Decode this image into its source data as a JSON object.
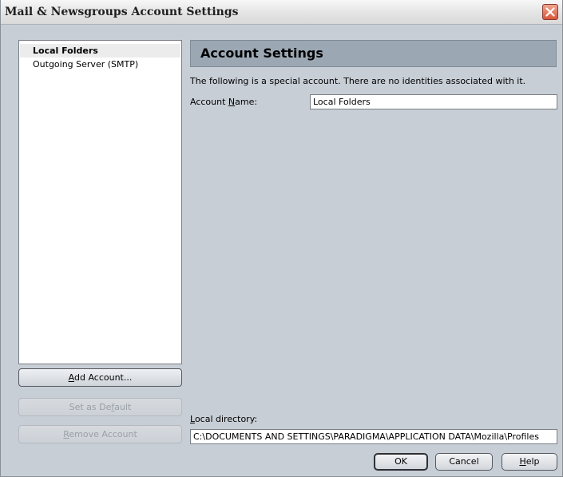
{
  "window": {
    "title": "Mail & Newsgroups Account Settings",
    "close_icon": "close-icon"
  },
  "sidebar": {
    "items": [
      {
        "label": "Local Folders",
        "selected": true
      },
      {
        "label": "Outgoing Server (SMTP)",
        "selected": false
      }
    ],
    "add_account": {
      "pre": "",
      "key": "A",
      "post": "dd Account..."
    },
    "set_default": {
      "pre": "Set as De",
      "key": "f",
      "post": "ault",
      "enabled": false
    },
    "remove_account": {
      "pre": "",
      "key": "R",
      "post": "emove Account",
      "enabled": false
    }
  },
  "panel": {
    "header": "Account Settings",
    "info": "The following is a special account. There are no identities associated with it.",
    "account_name_label": {
      "pre": "Account ",
      "key": "N",
      "post": "ame:"
    },
    "account_name_value": "Local Folders",
    "local_dir_label": {
      "pre": "",
      "key": "L",
      "post": "ocal directory:"
    },
    "local_dir_value": "C:\\DOCUMENTS AND SETTINGS\\PARADIGMA\\APPLICATION DATA\\Mozilla\\Profiles"
  },
  "buttons": {
    "ok": "OK",
    "cancel": "Cancel",
    "help": {
      "pre": "",
      "key": "H",
      "post": "elp"
    }
  },
  "colors": {
    "dialog_bg": "#c8ced6",
    "header_bg": "#9ba8b4",
    "close_button": "#d9573a"
  }
}
